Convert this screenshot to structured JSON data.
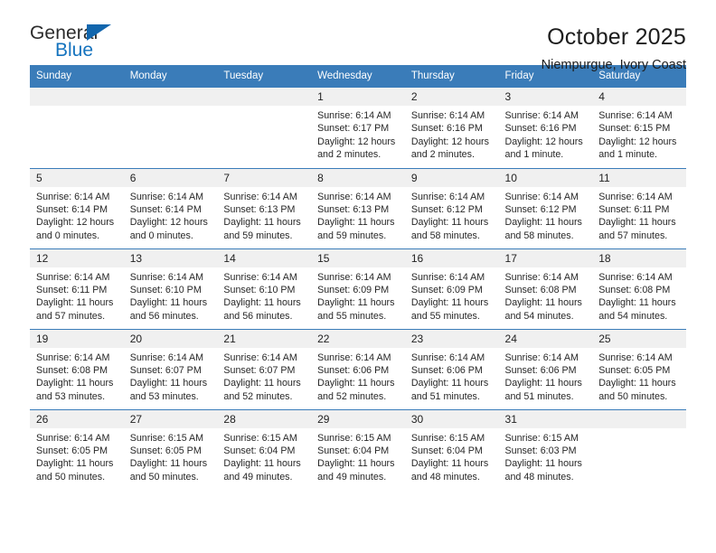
{
  "brand": {
    "name_top": "General",
    "name_bottom": "Blue",
    "accent_color": "#1573be",
    "triangle_color": "#1266ad"
  },
  "header": {
    "title": "October 2025",
    "subtitle": "Niempurgue, Ivory Coast"
  },
  "calendar": {
    "header_bg": "#3a7cb9",
    "daynum_bg": "#f0f0f0",
    "weekdays": [
      "Sunday",
      "Monday",
      "Tuesday",
      "Wednesday",
      "Thursday",
      "Friday",
      "Saturday"
    ],
    "weeks": [
      [
        {
          "day": "",
          "empty": true,
          "lines": []
        },
        {
          "day": "",
          "empty": true,
          "lines": []
        },
        {
          "day": "",
          "empty": true,
          "lines": []
        },
        {
          "day": "1",
          "lines": [
            "Sunrise: 6:14 AM",
            "Sunset: 6:17 PM",
            "Daylight: 12 hours",
            "and 2 minutes."
          ]
        },
        {
          "day": "2",
          "lines": [
            "Sunrise: 6:14 AM",
            "Sunset: 6:16 PM",
            "Daylight: 12 hours",
            "and 2 minutes."
          ]
        },
        {
          "day": "3",
          "lines": [
            "Sunrise: 6:14 AM",
            "Sunset: 6:16 PM",
            "Daylight: 12 hours",
            "and 1 minute."
          ]
        },
        {
          "day": "4",
          "lines": [
            "Sunrise: 6:14 AM",
            "Sunset: 6:15 PM",
            "Daylight: 12 hours",
            "and 1 minute."
          ]
        }
      ],
      [
        {
          "day": "5",
          "lines": [
            "Sunrise: 6:14 AM",
            "Sunset: 6:14 PM",
            "Daylight: 12 hours",
            "and 0 minutes."
          ]
        },
        {
          "day": "6",
          "lines": [
            "Sunrise: 6:14 AM",
            "Sunset: 6:14 PM",
            "Daylight: 12 hours",
            "and 0 minutes."
          ]
        },
        {
          "day": "7",
          "lines": [
            "Sunrise: 6:14 AM",
            "Sunset: 6:13 PM",
            "Daylight: 11 hours",
            "and 59 minutes."
          ]
        },
        {
          "day": "8",
          "lines": [
            "Sunrise: 6:14 AM",
            "Sunset: 6:13 PM",
            "Daylight: 11 hours",
            "and 59 minutes."
          ]
        },
        {
          "day": "9",
          "lines": [
            "Sunrise: 6:14 AM",
            "Sunset: 6:12 PM",
            "Daylight: 11 hours",
            "and 58 minutes."
          ]
        },
        {
          "day": "10",
          "lines": [
            "Sunrise: 6:14 AM",
            "Sunset: 6:12 PM",
            "Daylight: 11 hours",
            "and 58 minutes."
          ]
        },
        {
          "day": "11",
          "lines": [
            "Sunrise: 6:14 AM",
            "Sunset: 6:11 PM",
            "Daylight: 11 hours",
            "and 57 minutes."
          ]
        }
      ],
      [
        {
          "day": "12",
          "lines": [
            "Sunrise: 6:14 AM",
            "Sunset: 6:11 PM",
            "Daylight: 11 hours",
            "and 57 minutes."
          ]
        },
        {
          "day": "13",
          "lines": [
            "Sunrise: 6:14 AM",
            "Sunset: 6:10 PM",
            "Daylight: 11 hours",
            "and 56 minutes."
          ]
        },
        {
          "day": "14",
          "lines": [
            "Sunrise: 6:14 AM",
            "Sunset: 6:10 PM",
            "Daylight: 11 hours",
            "and 56 minutes."
          ]
        },
        {
          "day": "15",
          "lines": [
            "Sunrise: 6:14 AM",
            "Sunset: 6:09 PM",
            "Daylight: 11 hours",
            "and 55 minutes."
          ]
        },
        {
          "day": "16",
          "lines": [
            "Sunrise: 6:14 AM",
            "Sunset: 6:09 PM",
            "Daylight: 11 hours",
            "and 55 minutes."
          ]
        },
        {
          "day": "17",
          "lines": [
            "Sunrise: 6:14 AM",
            "Sunset: 6:08 PM",
            "Daylight: 11 hours",
            "and 54 minutes."
          ]
        },
        {
          "day": "18",
          "lines": [
            "Sunrise: 6:14 AM",
            "Sunset: 6:08 PM",
            "Daylight: 11 hours",
            "and 54 minutes."
          ]
        }
      ],
      [
        {
          "day": "19",
          "lines": [
            "Sunrise: 6:14 AM",
            "Sunset: 6:08 PM",
            "Daylight: 11 hours",
            "and 53 minutes."
          ]
        },
        {
          "day": "20",
          "lines": [
            "Sunrise: 6:14 AM",
            "Sunset: 6:07 PM",
            "Daylight: 11 hours",
            "and 53 minutes."
          ]
        },
        {
          "day": "21",
          "lines": [
            "Sunrise: 6:14 AM",
            "Sunset: 6:07 PM",
            "Daylight: 11 hours",
            "and 52 minutes."
          ]
        },
        {
          "day": "22",
          "lines": [
            "Sunrise: 6:14 AM",
            "Sunset: 6:06 PM",
            "Daylight: 11 hours",
            "and 52 minutes."
          ]
        },
        {
          "day": "23",
          "lines": [
            "Sunrise: 6:14 AM",
            "Sunset: 6:06 PM",
            "Daylight: 11 hours",
            "and 51 minutes."
          ]
        },
        {
          "day": "24",
          "lines": [
            "Sunrise: 6:14 AM",
            "Sunset: 6:06 PM",
            "Daylight: 11 hours",
            "and 51 minutes."
          ]
        },
        {
          "day": "25",
          "lines": [
            "Sunrise: 6:14 AM",
            "Sunset: 6:05 PM",
            "Daylight: 11 hours",
            "and 50 minutes."
          ]
        }
      ],
      [
        {
          "day": "26",
          "lines": [
            "Sunrise: 6:14 AM",
            "Sunset: 6:05 PM",
            "Daylight: 11 hours",
            "and 50 minutes."
          ]
        },
        {
          "day": "27",
          "lines": [
            "Sunrise: 6:15 AM",
            "Sunset: 6:05 PM",
            "Daylight: 11 hours",
            "and 50 minutes."
          ]
        },
        {
          "day": "28",
          "lines": [
            "Sunrise: 6:15 AM",
            "Sunset: 6:04 PM",
            "Daylight: 11 hours",
            "and 49 minutes."
          ]
        },
        {
          "day": "29",
          "lines": [
            "Sunrise: 6:15 AM",
            "Sunset: 6:04 PM",
            "Daylight: 11 hours",
            "and 49 minutes."
          ]
        },
        {
          "day": "30",
          "lines": [
            "Sunrise: 6:15 AM",
            "Sunset: 6:04 PM",
            "Daylight: 11 hours",
            "and 48 minutes."
          ]
        },
        {
          "day": "31",
          "lines": [
            "Sunrise: 6:15 AM",
            "Sunset: 6:03 PM",
            "Daylight: 11 hours",
            "and 48 minutes."
          ]
        },
        {
          "day": "",
          "empty": true,
          "lines": []
        }
      ]
    ]
  }
}
